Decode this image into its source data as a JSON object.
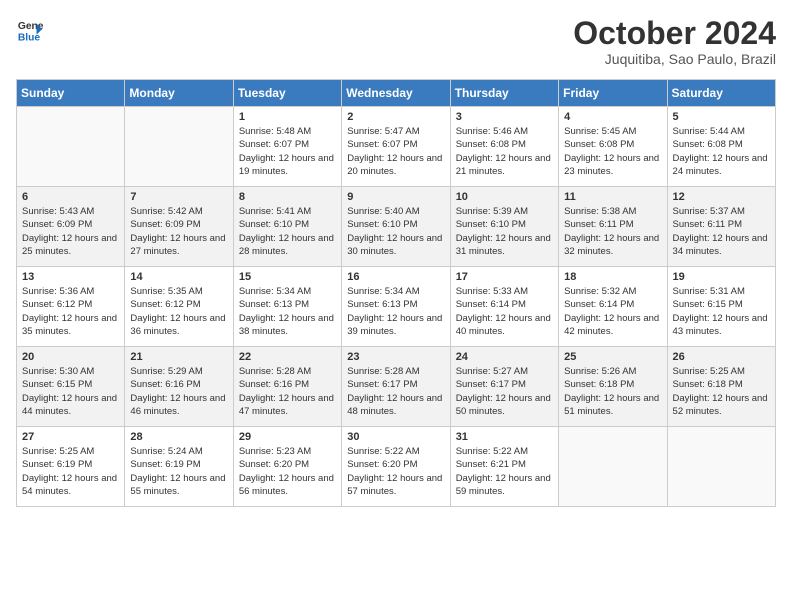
{
  "header": {
    "logo_line1": "General",
    "logo_line2": "Blue",
    "month_title": "October 2024",
    "subtitle": "Juquitiba, Sao Paulo, Brazil"
  },
  "weekdays": [
    "Sunday",
    "Monday",
    "Tuesday",
    "Wednesday",
    "Thursday",
    "Friday",
    "Saturday"
  ],
  "weeks": [
    [
      {
        "day": "",
        "sunrise": "",
        "sunset": "",
        "daylight": ""
      },
      {
        "day": "",
        "sunrise": "",
        "sunset": "",
        "daylight": ""
      },
      {
        "day": "1",
        "sunrise": "Sunrise: 5:48 AM",
        "sunset": "Sunset: 6:07 PM",
        "daylight": "Daylight: 12 hours and 19 minutes."
      },
      {
        "day": "2",
        "sunrise": "Sunrise: 5:47 AM",
        "sunset": "Sunset: 6:07 PM",
        "daylight": "Daylight: 12 hours and 20 minutes."
      },
      {
        "day": "3",
        "sunrise": "Sunrise: 5:46 AM",
        "sunset": "Sunset: 6:08 PM",
        "daylight": "Daylight: 12 hours and 21 minutes."
      },
      {
        "day": "4",
        "sunrise": "Sunrise: 5:45 AM",
        "sunset": "Sunset: 6:08 PM",
        "daylight": "Daylight: 12 hours and 23 minutes."
      },
      {
        "day": "5",
        "sunrise": "Sunrise: 5:44 AM",
        "sunset": "Sunset: 6:08 PM",
        "daylight": "Daylight: 12 hours and 24 minutes."
      }
    ],
    [
      {
        "day": "6",
        "sunrise": "Sunrise: 5:43 AM",
        "sunset": "Sunset: 6:09 PM",
        "daylight": "Daylight: 12 hours and 25 minutes."
      },
      {
        "day": "7",
        "sunrise": "Sunrise: 5:42 AM",
        "sunset": "Sunset: 6:09 PM",
        "daylight": "Daylight: 12 hours and 27 minutes."
      },
      {
        "day": "8",
        "sunrise": "Sunrise: 5:41 AM",
        "sunset": "Sunset: 6:10 PM",
        "daylight": "Daylight: 12 hours and 28 minutes."
      },
      {
        "day": "9",
        "sunrise": "Sunrise: 5:40 AM",
        "sunset": "Sunset: 6:10 PM",
        "daylight": "Daylight: 12 hours and 30 minutes."
      },
      {
        "day": "10",
        "sunrise": "Sunrise: 5:39 AM",
        "sunset": "Sunset: 6:10 PM",
        "daylight": "Daylight: 12 hours and 31 minutes."
      },
      {
        "day": "11",
        "sunrise": "Sunrise: 5:38 AM",
        "sunset": "Sunset: 6:11 PM",
        "daylight": "Daylight: 12 hours and 32 minutes."
      },
      {
        "day": "12",
        "sunrise": "Sunrise: 5:37 AM",
        "sunset": "Sunset: 6:11 PM",
        "daylight": "Daylight: 12 hours and 34 minutes."
      }
    ],
    [
      {
        "day": "13",
        "sunrise": "Sunrise: 5:36 AM",
        "sunset": "Sunset: 6:12 PM",
        "daylight": "Daylight: 12 hours and 35 minutes."
      },
      {
        "day": "14",
        "sunrise": "Sunrise: 5:35 AM",
        "sunset": "Sunset: 6:12 PM",
        "daylight": "Daylight: 12 hours and 36 minutes."
      },
      {
        "day": "15",
        "sunrise": "Sunrise: 5:34 AM",
        "sunset": "Sunset: 6:13 PM",
        "daylight": "Daylight: 12 hours and 38 minutes."
      },
      {
        "day": "16",
        "sunrise": "Sunrise: 5:34 AM",
        "sunset": "Sunset: 6:13 PM",
        "daylight": "Daylight: 12 hours and 39 minutes."
      },
      {
        "day": "17",
        "sunrise": "Sunrise: 5:33 AM",
        "sunset": "Sunset: 6:14 PM",
        "daylight": "Daylight: 12 hours and 40 minutes."
      },
      {
        "day": "18",
        "sunrise": "Sunrise: 5:32 AM",
        "sunset": "Sunset: 6:14 PM",
        "daylight": "Daylight: 12 hours and 42 minutes."
      },
      {
        "day": "19",
        "sunrise": "Sunrise: 5:31 AM",
        "sunset": "Sunset: 6:15 PM",
        "daylight": "Daylight: 12 hours and 43 minutes."
      }
    ],
    [
      {
        "day": "20",
        "sunrise": "Sunrise: 5:30 AM",
        "sunset": "Sunset: 6:15 PM",
        "daylight": "Daylight: 12 hours and 44 minutes."
      },
      {
        "day": "21",
        "sunrise": "Sunrise: 5:29 AM",
        "sunset": "Sunset: 6:16 PM",
        "daylight": "Daylight: 12 hours and 46 minutes."
      },
      {
        "day": "22",
        "sunrise": "Sunrise: 5:28 AM",
        "sunset": "Sunset: 6:16 PM",
        "daylight": "Daylight: 12 hours and 47 minutes."
      },
      {
        "day": "23",
        "sunrise": "Sunrise: 5:28 AM",
        "sunset": "Sunset: 6:17 PM",
        "daylight": "Daylight: 12 hours and 48 minutes."
      },
      {
        "day": "24",
        "sunrise": "Sunrise: 5:27 AM",
        "sunset": "Sunset: 6:17 PM",
        "daylight": "Daylight: 12 hours and 50 minutes."
      },
      {
        "day": "25",
        "sunrise": "Sunrise: 5:26 AM",
        "sunset": "Sunset: 6:18 PM",
        "daylight": "Daylight: 12 hours and 51 minutes."
      },
      {
        "day": "26",
        "sunrise": "Sunrise: 5:25 AM",
        "sunset": "Sunset: 6:18 PM",
        "daylight": "Daylight: 12 hours and 52 minutes."
      }
    ],
    [
      {
        "day": "27",
        "sunrise": "Sunrise: 5:25 AM",
        "sunset": "Sunset: 6:19 PM",
        "daylight": "Daylight: 12 hours and 54 minutes."
      },
      {
        "day": "28",
        "sunrise": "Sunrise: 5:24 AM",
        "sunset": "Sunset: 6:19 PM",
        "daylight": "Daylight: 12 hours and 55 minutes."
      },
      {
        "day": "29",
        "sunrise": "Sunrise: 5:23 AM",
        "sunset": "Sunset: 6:20 PM",
        "daylight": "Daylight: 12 hours and 56 minutes."
      },
      {
        "day": "30",
        "sunrise": "Sunrise: 5:22 AM",
        "sunset": "Sunset: 6:20 PM",
        "daylight": "Daylight: 12 hours and 57 minutes."
      },
      {
        "day": "31",
        "sunrise": "Sunrise: 5:22 AM",
        "sunset": "Sunset: 6:21 PM",
        "daylight": "Daylight: 12 hours and 59 minutes."
      },
      {
        "day": "",
        "sunrise": "",
        "sunset": "",
        "daylight": ""
      },
      {
        "day": "",
        "sunrise": "",
        "sunset": "",
        "daylight": ""
      }
    ]
  ]
}
